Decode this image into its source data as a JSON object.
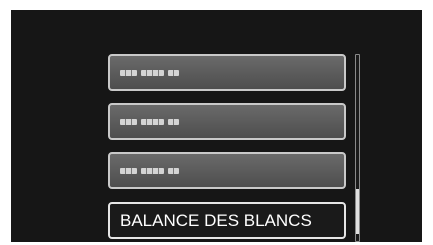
{
  "menu": {
    "items": [
      {
        "label": "",
        "placeholder_groups": [
          3,
          4,
          2
        ],
        "selected": false
      },
      {
        "label": "",
        "placeholder_groups": [
          3,
          4,
          2
        ],
        "selected": false
      },
      {
        "label": "",
        "placeholder_groups": [
          3,
          4,
          2
        ],
        "selected": false
      },
      {
        "label": "BALANCE DES BLANCS",
        "selected": true
      }
    ]
  },
  "scrollbar": {
    "position": 0.95
  },
  "colors": {
    "screen": "#161616",
    "item_fill": "#5c5c5c",
    "item_border": "#c9c9c9",
    "selected_fill": "#1a1a1a",
    "text": "#ffffff"
  }
}
